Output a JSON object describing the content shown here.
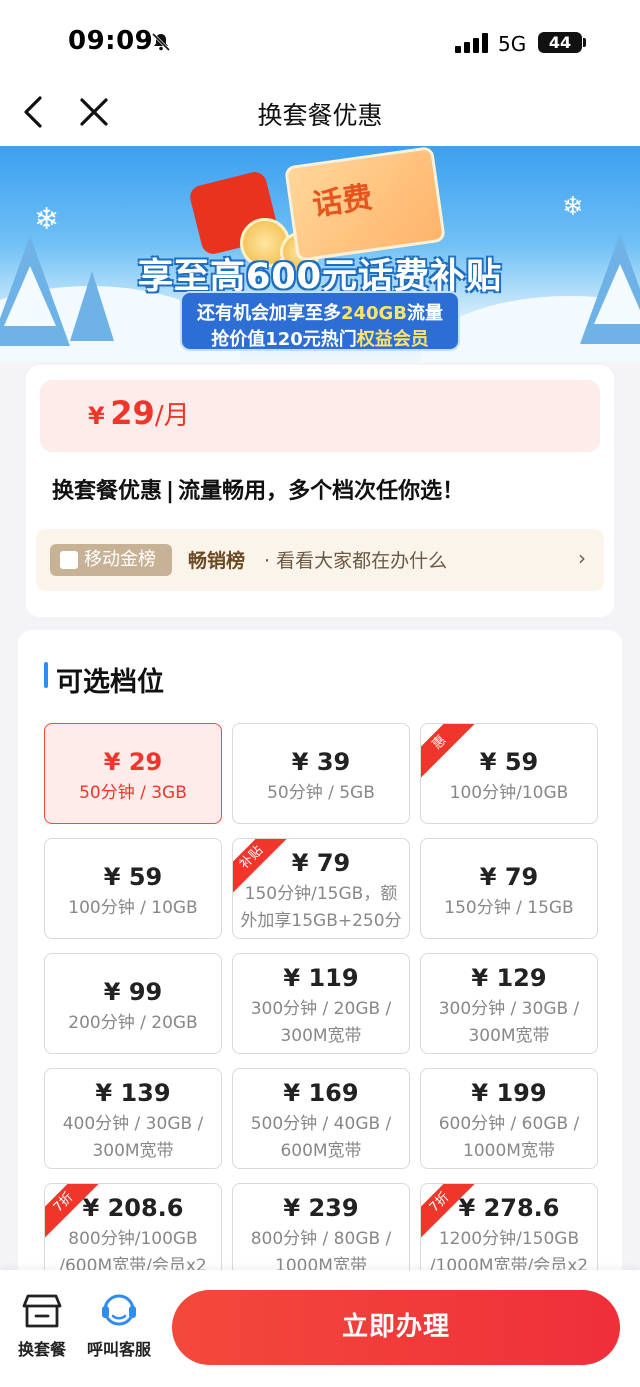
{
  "status_bar": {
    "time": "09:09",
    "network": "5G",
    "battery": "44"
  },
  "nav": {
    "title": "换套餐优惠"
  },
  "banner": {
    "headline": "享至高600元话费补贴",
    "gift_text": "话费",
    "line1": {
      "a": "还有机会加享至多",
      "b": "240GB",
      "c": "流量"
    },
    "line2": {
      "a": "抢价值120元热门",
      "b": "权益会员"
    }
  },
  "summary": {
    "currency": "¥",
    "price": "29",
    "unit": "/月",
    "title": "换套餐优惠",
    "subtitle": "流量畅用，多个档次任你选！",
    "rank": {
      "badge": "移动金榜",
      "title": "畅销榜",
      "subtitle": "· 看看大家都在办什么"
    }
  },
  "plans_section": {
    "title": "可选档位",
    "plans": [
      {
        "price": "¥ 29",
        "desc": "50分钟 / 3GB",
        "tag": "",
        "selected": true
      },
      {
        "price": "¥ 39",
        "desc": "50分钟 / 5GB",
        "tag": ""
      },
      {
        "price": "¥ 59",
        "desc": "100分钟/10GB",
        "tag": "惠"
      },
      {
        "price": "¥ 59",
        "desc": "100分钟 / 10GB",
        "tag": ""
      },
      {
        "price": "¥ 79",
        "desc": "150分钟/15GB，额外加享15GB+250分钟",
        "tag": "补贴"
      },
      {
        "price": "¥ 79",
        "desc": "150分钟 / 15GB",
        "tag": ""
      },
      {
        "price": "¥ 99",
        "desc": "200分钟 / 20GB",
        "tag": ""
      },
      {
        "price": "¥ 119",
        "desc": "300分钟 / 20GB / 300M宽带",
        "tag": ""
      },
      {
        "price": "¥ 129",
        "desc": "300分钟 / 30GB / 300M宽带",
        "tag": ""
      },
      {
        "price": "¥ 139",
        "desc": "400分钟 / 30GB / 300M宽带",
        "tag": ""
      },
      {
        "price": "¥ 169",
        "desc": "500分钟 / 40GB / 600M宽带",
        "tag": ""
      },
      {
        "price": "¥ 199",
        "desc": "600分钟 / 60GB / 1000M宽带",
        "tag": ""
      },
      {
        "price": "¥ 208.6",
        "desc": "800分钟/100GB /600M宽带/会员x2",
        "tag": "7折"
      },
      {
        "price": "¥ 239",
        "desc": "800分钟 / 80GB / 1000M宽带",
        "tag": ""
      },
      {
        "price": "¥ 278.6",
        "desc": "1200分钟/150GB /1000M宽带/会员x2",
        "tag": "7折"
      }
    ]
  },
  "bottom": {
    "switch_label": "换套餐",
    "service_label": "呼叫客服",
    "cta_label": "立即办理"
  },
  "colors": {
    "accent": "#f0362b",
    "blue": "#2f8cf0"
  }
}
